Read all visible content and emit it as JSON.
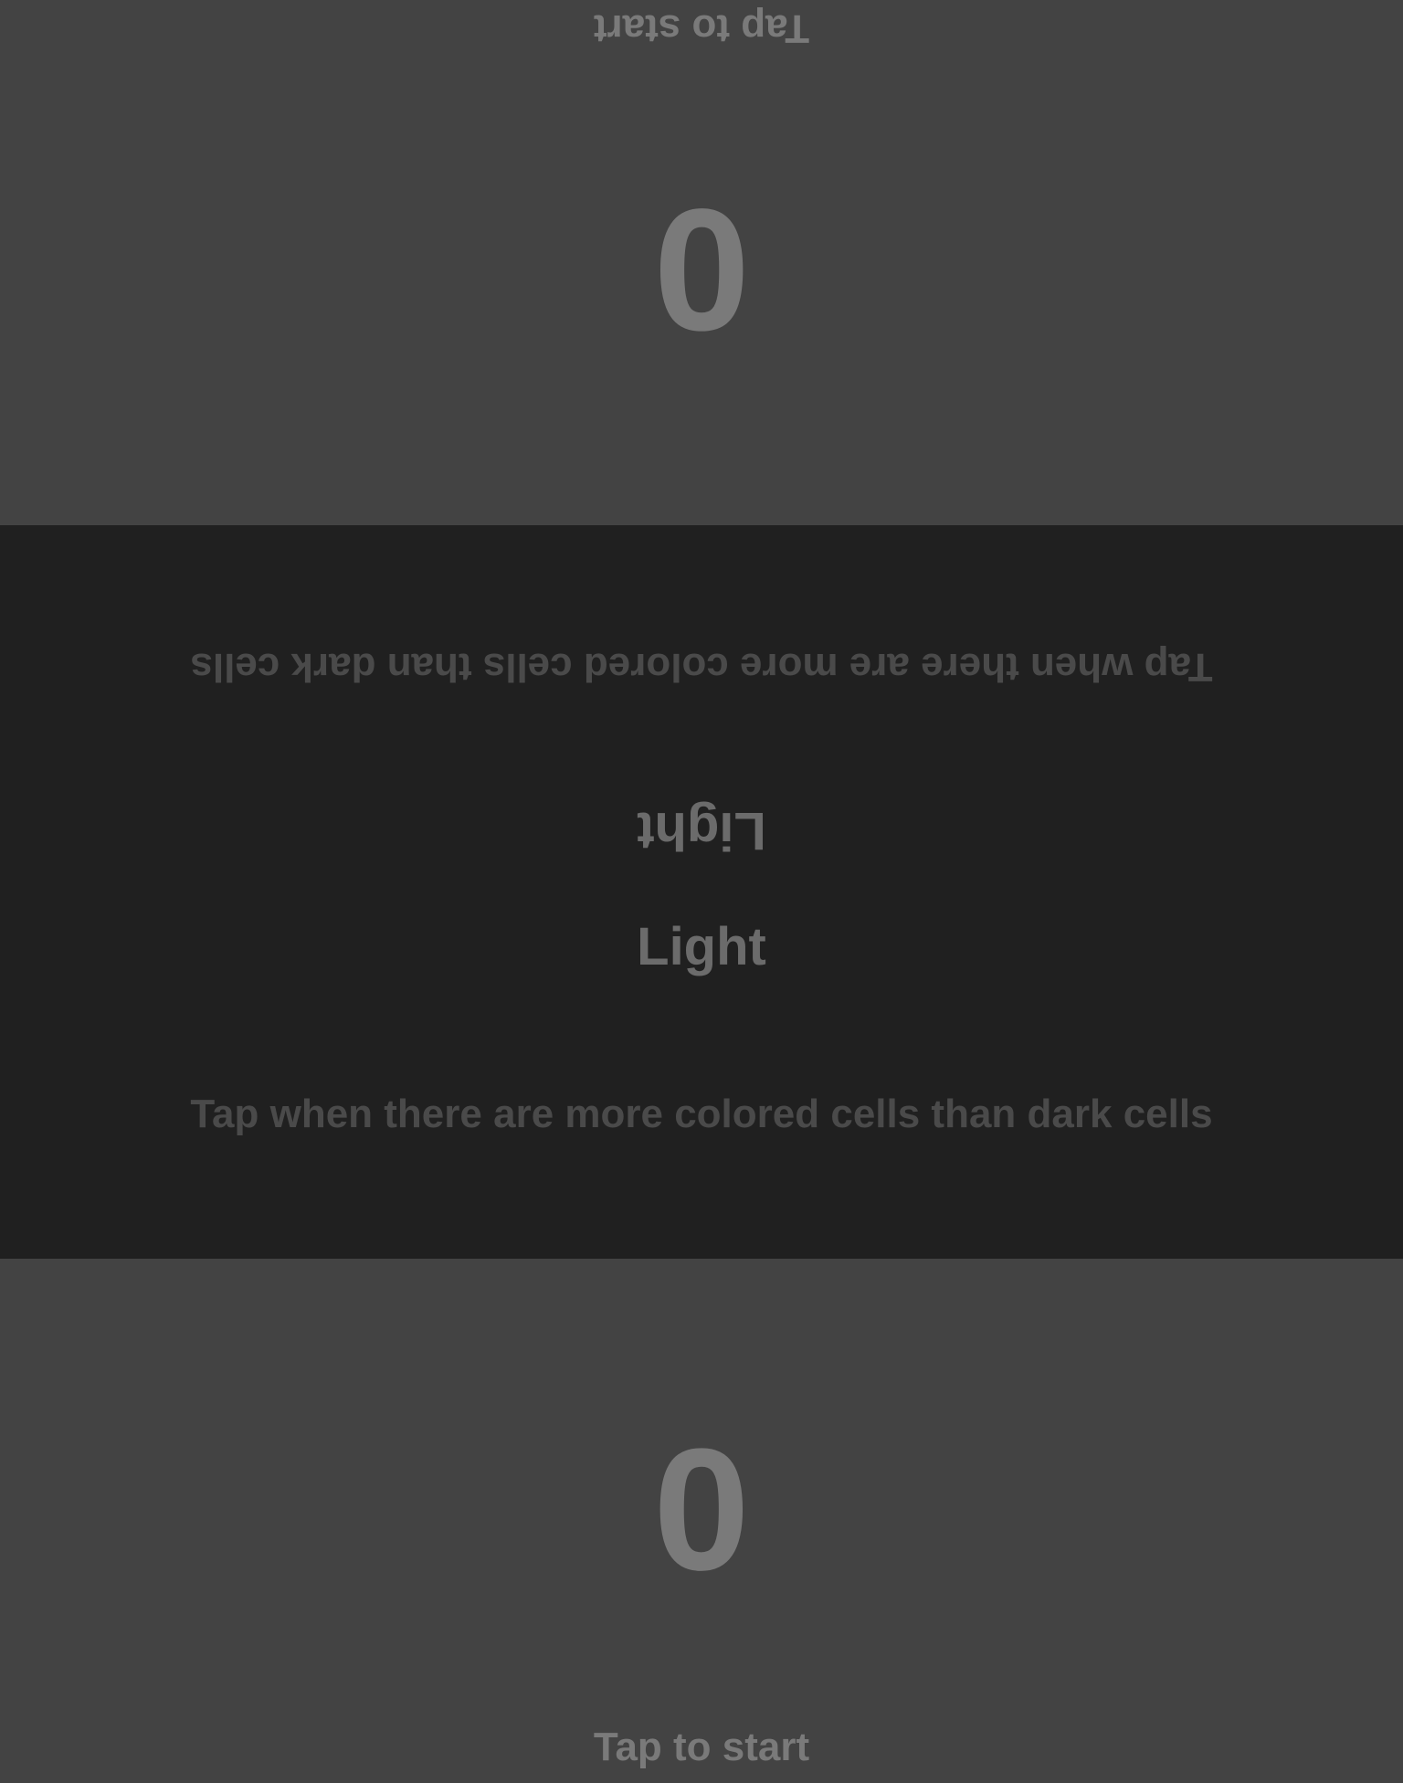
{
  "top_player": {
    "score": "0",
    "prompt": "Tap to start"
  },
  "bottom_player": {
    "score": "0",
    "prompt": "Tap to start"
  },
  "center": {
    "mode_label": "Light",
    "rule_text": "Tap when there are more colored cells than dark cells"
  },
  "colors": {
    "player_zone_bg": "#434343",
    "center_bg": "#202020",
    "score_text": "#7a7a7a",
    "rule_text": "#4a4a4a",
    "mode_text": "#6b6b6b"
  }
}
